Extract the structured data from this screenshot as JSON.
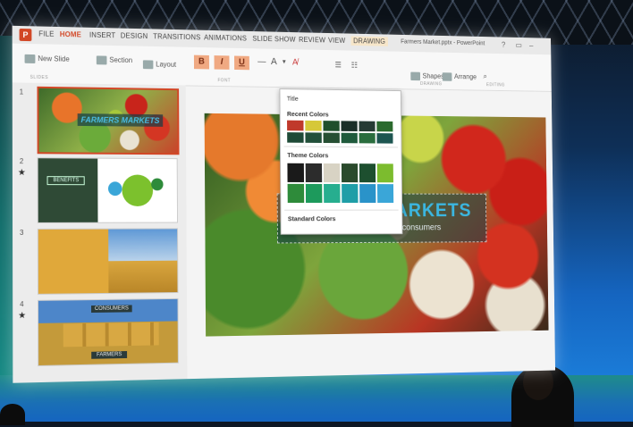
{
  "app": {
    "file_name": "Farmers Market.pptx - PowerPoint",
    "logo": "P"
  },
  "menu": {
    "tabs": [
      "FILE",
      "HOME",
      "INSERT",
      "DESIGN",
      "TRANSITIONS",
      "ANIMATIONS",
      "SLIDE SHOW",
      "REVIEW",
      "VIEW",
      "DRAWING"
    ],
    "active_tab": "HOME"
  },
  "ribbon": {
    "new_slide": "New Slide",
    "section": "Section",
    "layout": "Layout",
    "bold": "B",
    "italic": "I",
    "underline": "U",
    "font_color": "A",
    "shapes": "Shapes",
    "arrange": "Arrange",
    "group_slides": "SLIDES",
    "group_font": "FONT",
    "group_drawing": "DRAWING",
    "group_editing": "EDITING"
  },
  "thumbnails": [
    {
      "number": "1",
      "title": "FARMERS MARKETS"
    },
    {
      "number": "2",
      "title": "BENEFITS"
    },
    {
      "number": "3",
      "title": ""
    },
    {
      "number": "4",
      "title": "CONSUMERS",
      "footer": "FARMERS"
    }
  ],
  "slide": {
    "title": "ARKETS",
    "subtitle": "Linking farmers to consumers"
  },
  "color_picker": {
    "title": "Title",
    "recent_label": "Recent Colors",
    "theme_label": "Theme Colors",
    "standard_label": "Standard Colors",
    "recent_colors": [
      "#c0392b",
      "#d6c838",
      "#1f4f2c",
      "#1a2e28",
      "#263b34",
      "#2b6a2e",
      "#1e4a37",
      "#22503a",
      "#264f33",
      "#1f5a3c",
      "#2a6d3e",
      "#1d5550"
    ],
    "theme_colors": [
      "#1a1a1a",
      "#2c2c2c",
      "#d8d3c4",
      "#2a4a2c",
      "#1d4f2f",
      "#7cbc2e",
      "#2e8b3a",
      "#1d9a5c",
      "#27ae8f",
      "#1f9ea7",
      "#2a93c9",
      "#3aa6d8"
    ]
  }
}
